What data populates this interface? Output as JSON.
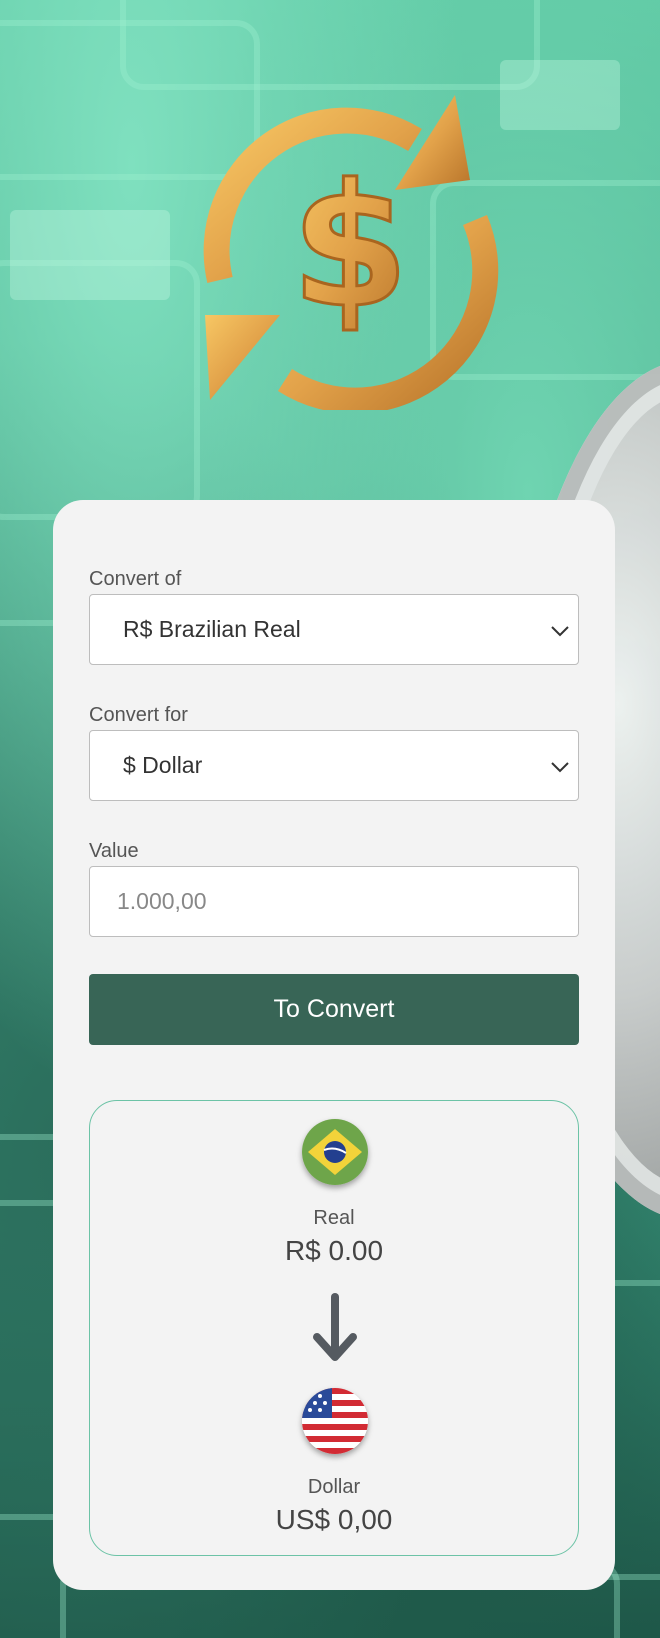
{
  "form": {
    "from_label": "Convert of",
    "from_selected": "R$ Brazilian Real",
    "to_label": "Convert for",
    "to_selected": "$ Dollar",
    "value_label": "Value",
    "value_placeholder": "1.000,00",
    "convert_button": "To Convert"
  },
  "result": {
    "from_currency_name": "Real",
    "from_currency_value": "R$ 0.00",
    "to_currency_name": "Dollar",
    "to_currency_value": "US$ 0,00",
    "from_flag_icon": "brazil-flag-icon",
    "to_flag_icon": "usa-flag-icon",
    "arrow_icon": "arrow-down-icon"
  },
  "colors": {
    "button": "#386556",
    "card": "#f3f3f3",
    "result_border": "#6cc3a6"
  }
}
